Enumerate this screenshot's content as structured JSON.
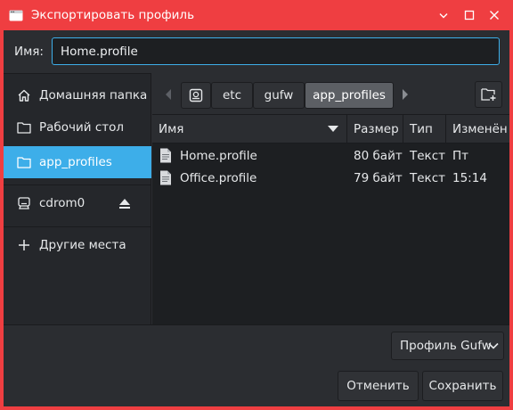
{
  "window": {
    "title": "Экспортировать профиль",
    "buttons": [
      "minimize-icon",
      "maximize-icon",
      "close-icon"
    ],
    "titlebar_color": "#ef3e41"
  },
  "name_field": {
    "label": "Имя:",
    "value": "Home.profile"
  },
  "sidebar": {
    "items": [
      {
        "label": "Домашняя папка",
        "icon": "home-icon"
      },
      {
        "label": "Рабочий стол",
        "icon": "folder-icon"
      },
      {
        "label": "app_profiles",
        "icon": "folder-icon",
        "active": true
      },
      {
        "label": "cdrom0",
        "icon": "drive-icon"
      },
      {
        "label": "Другие места",
        "icon": "plus-icon"
      }
    ]
  },
  "pathbar": {
    "crumbs": [
      "etc",
      "gufw",
      "app_profiles"
    ],
    "active_crumb": "app_profiles"
  },
  "filelist": {
    "columns": [
      "Имя",
      "Размер",
      "Тип",
      "Изменён"
    ],
    "rows": [
      {
        "name": "Home.profile",
        "size": "80 байт",
        "type": "Текст",
        "modified": "Пт"
      },
      {
        "name": "Office.profile",
        "size": "79 байт",
        "type": "Текст",
        "modified": "15:14"
      }
    ]
  },
  "filter": {
    "selected": "Профиль Gufw"
  },
  "actions": {
    "cancel": "Отменить",
    "save": "Сохранить"
  },
  "colors": {
    "accent": "#3daee9",
    "background": "#2b2d31"
  }
}
